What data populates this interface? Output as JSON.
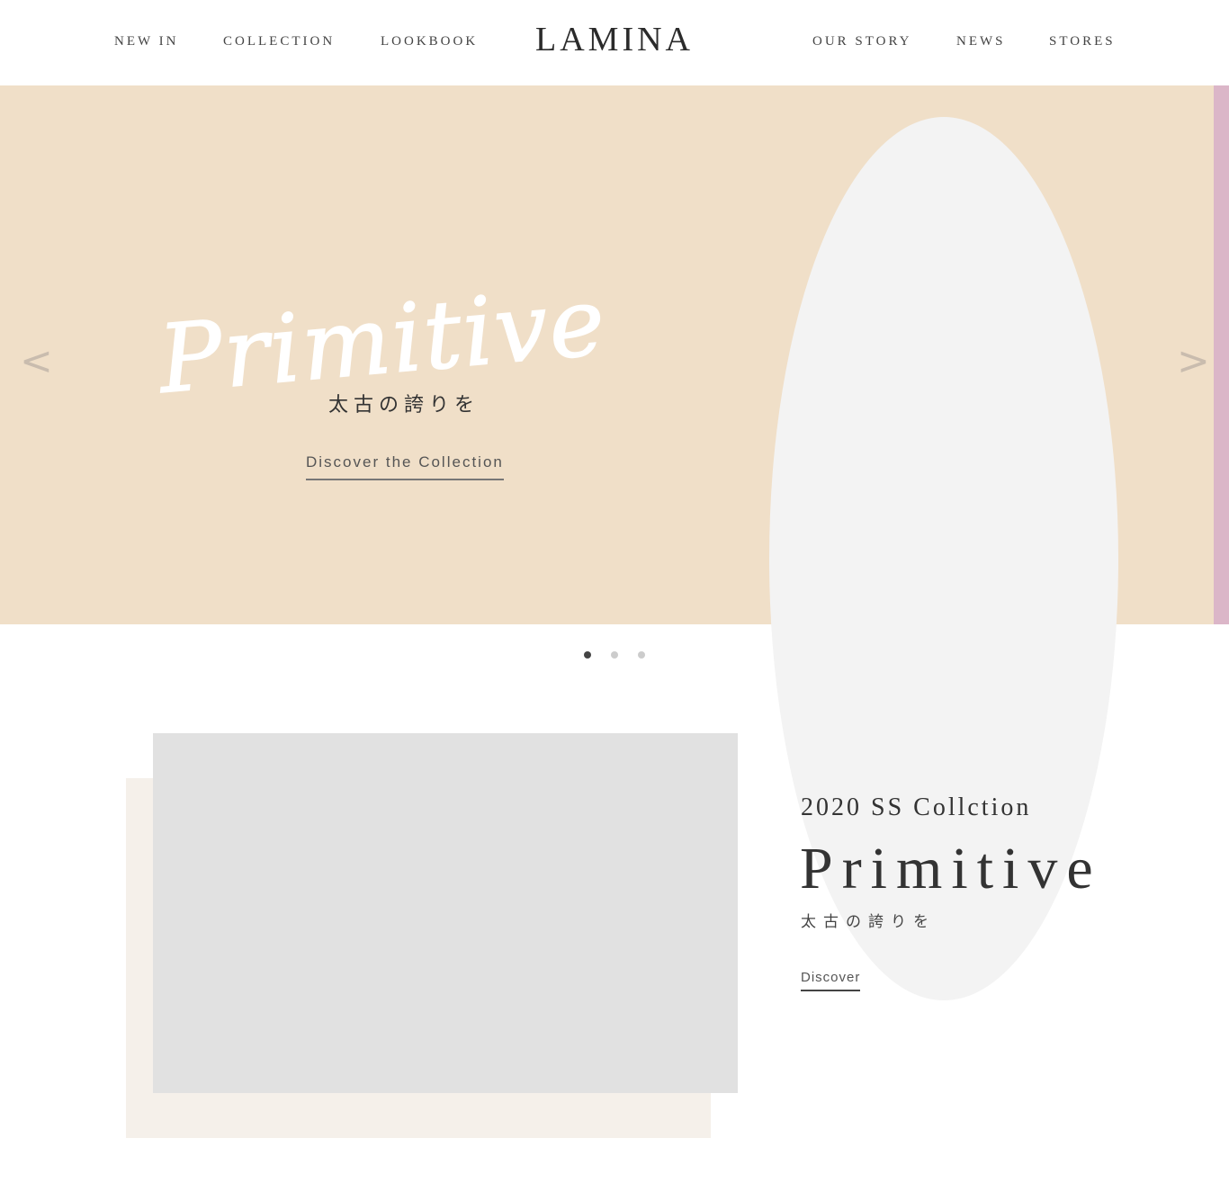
{
  "header": {
    "logo": "LAMINA",
    "nav_left": [
      "NEW IN",
      "COLLECTION",
      "LOOKBOOK"
    ],
    "nav_right": [
      "OUR STORY",
      "NEWS",
      "STORES"
    ]
  },
  "hero": {
    "script_title": "Primitive",
    "subtitle": "太古の誇りを",
    "cta": "Discover the Collection",
    "prev_arrow": "<",
    "next_arrow": ">",
    "prev_icon": "chevron-left-icon",
    "next_icon": "chevron-right-icon",
    "slide_count": 3,
    "active_slide": 1
  },
  "feature": {
    "season": "2020 SS Collction",
    "title": "Primitive",
    "subtitle": "太古の誇りを",
    "cta": "Discover"
  },
  "colors": {
    "hero_bg": "#f0dfc8",
    "next_slide_peek": "#dbb6c8",
    "oval": "#f3f3f3",
    "image_placeholder": "#e1e1e1",
    "image_backdrop": "#f5f0ea",
    "text": "#333333"
  }
}
